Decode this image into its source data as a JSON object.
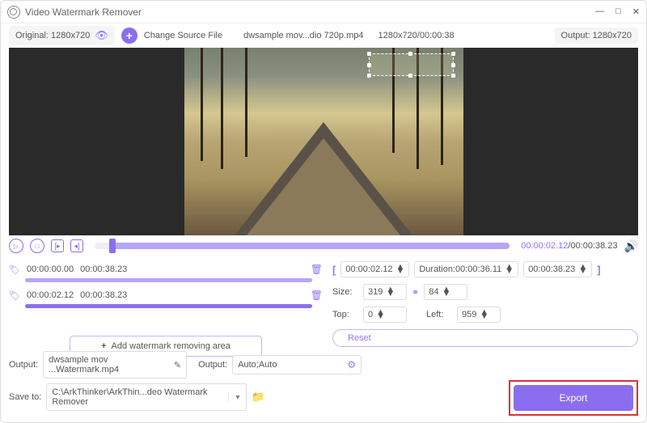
{
  "title": "Video Watermark Remover",
  "toolbar": {
    "original": "Original: 1280x720",
    "change_source": "Change Source File",
    "filename": "dwsample mov...dio 720p.mp4",
    "resinfo": "1280x720/00:00:38",
    "output": "Output: 1280x720"
  },
  "play": {
    "current": "00:00:02.12",
    "total": "/00:00:38.23"
  },
  "segments": [
    {
      "start": "00:00:00.00",
      "end": "00:00:38.23"
    },
    {
      "start": "00:00:02.12",
      "end": "00:00:38.23"
    }
  ],
  "addwm": "Add watermark removing area",
  "range": {
    "start": "00:00:02.12",
    "dur": "Duration:00:00:36.11",
    "end": "00:00:38.23"
  },
  "size": {
    "lbl": "Size:",
    "w": "319",
    "h": "84"
  },
  "pos": {
    "top_lbl": "Top:",
    "top": "0",
    "left_lbl": "Left:",
    "left": "959"
  },
  "reset": "Reset",
  "out": {
    "lbl1": "Output:",
    "file": "dwsample mov ...Watermark.mp4",
    "lbl2": "Output:",
    "fmt": "Auto;Auto",
    "save_lbl": "Save to:",
    "path": "C:\\ArkThinker\\ArkThin...deo Watermark Remover"
  },
  "export": "Export"
}
